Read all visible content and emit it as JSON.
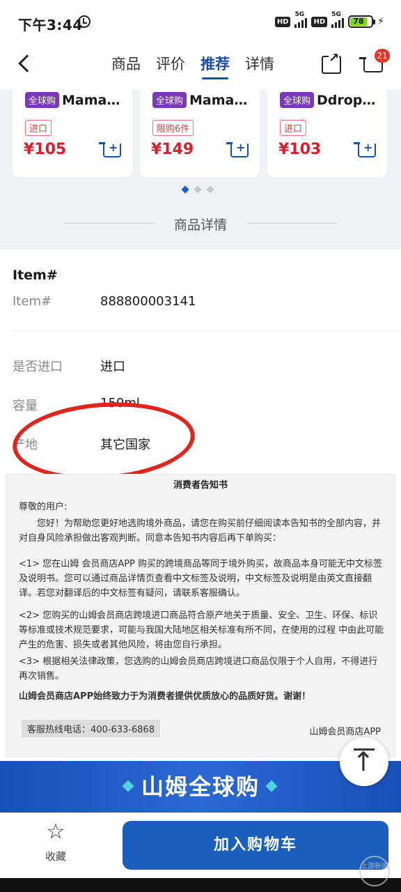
{
  "status_bar": {
    "time": "下午3:44",
    "network1": "5G",
    "network2": "5G",
    "battery": "78",
    "battery_level": 0.78
  },
  "nav": {
    "tabs": [
      {
        "label": "商品",
        "active": false
      },
      {
        "label": "评价",
        "active": false
      },
      {
        "label": "推荐",
        "active": true
      },
      {
        "label": "详情",
        "active": false
      }
    ],
    "cart_count": "21",
    "icons": [
      "back-icon",
      "share-icon",
      "cart-icon"
    ]
  },
  "recommend": {
    "cards": [
      {
        "tag": "全球购",
        "name": "Mama…",
        "badge": "进口",
        "price": "¥105"
      },
      {
        "tag": "全球购",
        "name": "Mama…",
        "badge": "限购6件",
        "price": "¥149"
      },
      {
        "tag": "全球购",
        "name": "Ddrop…",
        "badge": "进口",
        "price": "¥103"
      }
    ],
    "carousel_pages": 3,
    "carousel_active": 0,
    "section_title": "商品详情"
  },
  "detail": {
    "heading": "Item#",
    "rows": [
      {
        "key": "Item#",
        "value": "888800003141"
      },
      {
        "key": "是否进口",
        "value": "进口"
      },
      {
        "key": "容量",
        "value": "150ml"
      },
      {
        "key": "产地",
        "value": "其它国家"
      }
    ]
  },
  "notice": {
    "title": "消费者告知书",
    "greeting": "尊敬的用户:",
    "p1": "您好！为帮助您更好地选购境外商品，请您在购买前仔细阅读本告知书的全部内容，并对自身风险承担做出客观判断。同意本告知书内容后再下单购买：",
    "p2": "<1> 您在山姆 会员商店APP 购买的跨境商品等同于境外购买，故商品本身可能无中文标签及说明书。您可以通过商品详情页查看中文标签及说明，中文标签及说明是由英文直接翻译。若您对翻译后的中文标签有疑问，请联系客服确认。",
    "p3": "<2> 您购买的山姆会员商店跨境进口商品符合原产地关于质量、安全、卫生、环保、标识 等标准或技术规范要求，可能与我国大陆地区相关标准有所不同，在使用的过程 中由此可能产生的危害、损失或者其他风险，将由您自行承担。",
    "p4": "<3> 根据相关法律政策，您选购的山姆会员商店跨境进口商品仅限于个人自用，不得进行再次销售。",
    "p5": "山姆会员商店APP始终致力于为消费者提供优质放心的品质好货。谢谢！",
    "hotline": "客服热线电话：400-633-6868",
    "signature": "山姆会员商店APP"
  },
  "banner": {
    "text": "山姆全球购"
  },
  "bottom": {
    "favorite_label": "收藏",
    "add_to_cart": "加入购物车"
  },
  "watermark": "上游新闻",
  "colors": {
    "accent": "#1a4fa8",
    "price": "#d8202a",
    "circle": "#e0251c",
    "global_tag": "#7a3ab8"
  }
}
